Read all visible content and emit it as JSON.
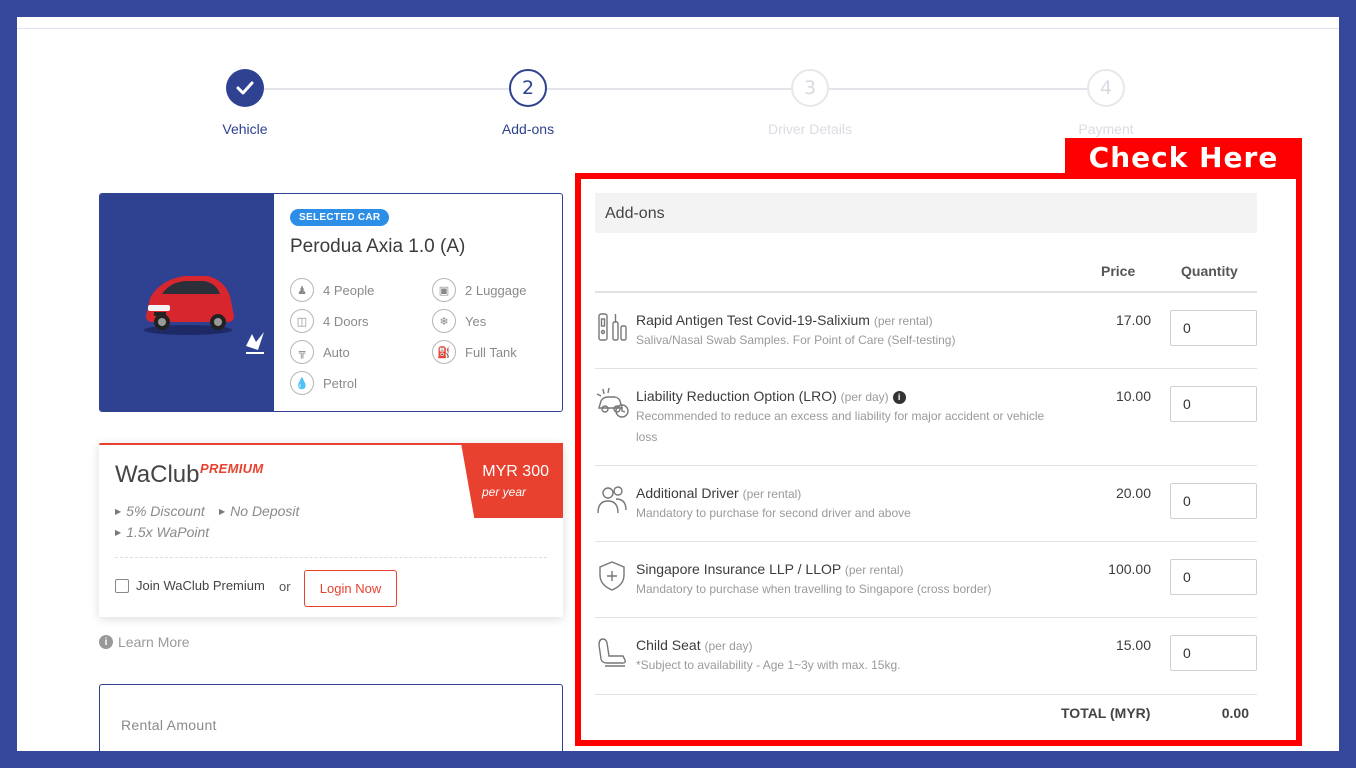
{
  "stepper": {
    "steps": [
      {
        "number": "",
        "label": "Vehicle",
        "state": "done"
      },
      {
        "number": "2",
        "label": "Add-ons",
        "state": "active"
      },
      {
        "number": "3",
        "label": "Driver Details",
        "state": "pending"
      },
      {
        "number": "4",
        "label": "Payment",
        "state": "pending"
      }
    ]
  },
  "car": {
    "badge": "SELECTED CAR",
    "name": "Perodua Axia 1.0 (A)",
    "specs": {
      "people": "4 People",
      "luggage": "2 Luggage",
      "doors": "4 Doors",
      "aircon": "Yes",
      "transmission": "Auto",
      "fuel_policy": "Full Tank",
      "fuel_type": "Petrol"
    }
  },
  "waclub": {
    "brand": "WaClub",
    "tier": "PREMIUM",
    "price": "MYR 300",
    "period": "per year",
    "perks": [
      "5% Discount",
      "No Deposit",
      "1.5x WaPoint"
    ],
    "join_label": "Join WaClub Premium",
    "or_label": "or",
    "login_label": "Login Now"
  },
  "learn_more": "Learn More",
  "rental": {
    "label": "Rental Amount"
  },
  "callout": {
    "label": "Check Here"
  },
  "addons": {
    "title": "Add-ons",
    "col_price": "Price",
    "col_quantity": "Quantity",
    "items": [
      {
        "title": "Rapid Antigen Test Covid-19-Salixium",
        "unit": "(per rental)",
        "desc": "Saliva/Nasal Swab Samples. For Point of Care (Self-testing)",
        "price": "17.00",
        "qty": "0",
        "icon": "test-kit-icon"
      },
      {
        "title": "Liability Reduction Option (LRO)",
        "unit": "(per day)",
        "desc": "Recommended to reduce an excess and liability for major accident or vehicle loss",
        "price": "10.00",
        "qty": "0",
        "icon": "car-crash-icon"
      },
      {
        "title": "Additional Driver",
        "unit": "(per rental)",
        "desc": "Mandatory to purchase for second driver and above",
        "price": "20.00",
        "qty": "0",
        "icon": "people-icon"
      },
      {
        "title": "Singapore Insurance LLP / LLOP",
        "unit": "(per rental)",
        "desc": "Mandatory to purchase when travelling to Singapore (cross border)",
        "price": "100.00",
        "qty": "0",
        "icon": "shield-icon"
      },
      {
        "title": "Child Seat",
        "unit": "(per day)",
        "desc": "*Subject to availability - Age 1~3y with max. 15kg.",
        "price": "15.00",
        "qty": "0",
        "icon": "child-seat-icon"
      }
    ],
    "total_label": "TOTAL (MYR)",
    "total_value": "0.00"
  },
  "colors": {
    "brand_blue": "#2f4191",
    "frame": "#34479a",
    "accent_red": "#e8412f",
    "callout_red": "#ff0000",
    "badge_blue": "#2d8ee8"
  }
}
